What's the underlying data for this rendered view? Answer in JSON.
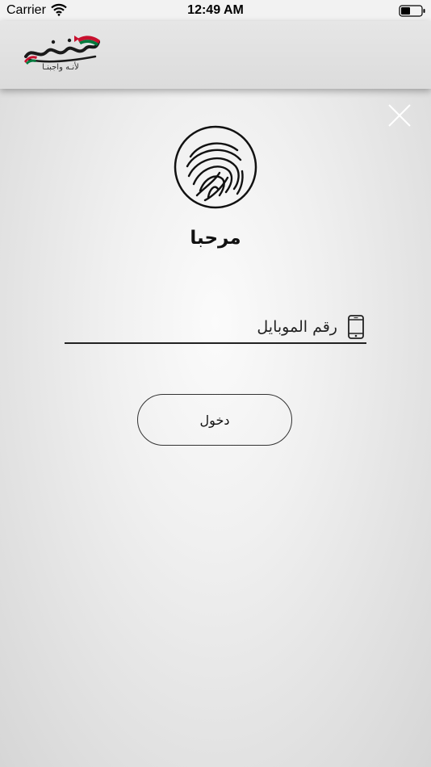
{
  "status_bar": {
    "carrier": "Carrier",
    "time": "12:49 AM"
  },
  "header": {
    "logo_text": "لأنـه واجبنـا"
  },
  "icons": {
    "wifi": "wifi-icon",
    "battery": "battery-icon",
    "close": "close-icon",
    "fingerprint": "fingerprint-icon",
    "phone": "mobile-phone-icon"
  },
  "main": {
    "welcome": "مرحبا",
    "phone_placeholder": "رقم الموبايل",
    "login_label": "دخول"
  },
  "colors": {
    "flag_red": "#c8102e",
    "flag_green": "#007a3d",
    "text": "#111111"
  }
}
